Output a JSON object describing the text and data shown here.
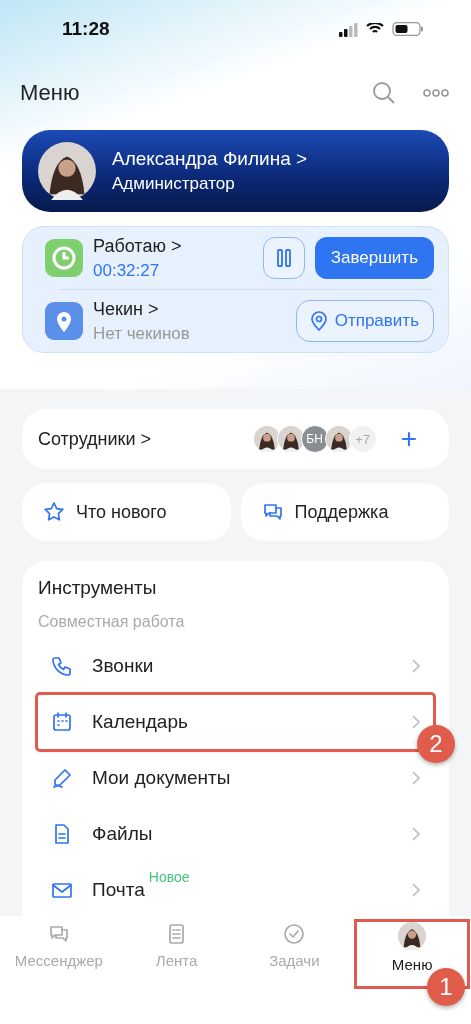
{
  "status_bar": {
    "time": "11:28"
  },
  "header": {
    "title": "Меню"
  },
  "profile": {
    "name": "Александра Филина",
    "chevron": ">",
    "role": "Администратор"
  },
  "work": {
    "status": "Работаю",
    "chevron": ">",
    "timer": "00:32:27",
    "paused": false,
    "finish_button": "Завершить"
  },
  "checkin": {
    "title": "Чекин",
    "chevron": ">",
    "subtitle": "Нет чекинов",
    "send_button": "Отправить"
  },
  "employees": {
    "label": "Сотрудники",
    "chevron": ">",
    "avatars": [
      {
        "kind": "photo"
      },
      {
        "kind": "photo"
      },
      {
        "kind": "initials",
        "text": "БН"
      },
      {
        "kind": "photo"
      }
    ],
    "more": "+7",
    "add": "+"
  },
  "quick_links": [
    {
      "kind": "star",
      "label": "Что нового"
    },
    {
      "kind": "chat",
      "label": "Поддержка"
    }
  ],
  "tools": {
    "title": "Инструменты",
    "section": "Совместная работа",
    "items": [
      {
        "kind": "phone",
        "label": "Звонки",
        "highlighted": false
      },
      {
        "kind": "calendar",
        "label": "Календарь",
        "highlighted": true,
        "annotation": "2"
      },
      {
        "kind": "pen",
        "label": "Мои документы",
        "highlighted": false
      },
      {
        "kind": "file",
        "label": "Файлы",
        "highlighted": false
      },
      {
        "kind": "mail",
        "label": "Почта",
        "badge": "Новое",
        "highlighted": false
      }
    ]
  },
  "tab_bar": [
    {
      "kind": "chat",
      "label": "Мессенджер",
      "selected": false,
      "highlighted": false
    },
    {
      "kind": "feed",
      "label": "Лента",
      "selected": false,
      "highlighted": false
    },
    {
      "kind": "check",
      "label": "Задачи",
      "selected": false,
      "highlighted": false
    },
    {
      "kind": "avatar",
      "label": "Меню",
      "selected": true,
      "highlighted": true,
      "annotation": "1"
    }
  ]
}
